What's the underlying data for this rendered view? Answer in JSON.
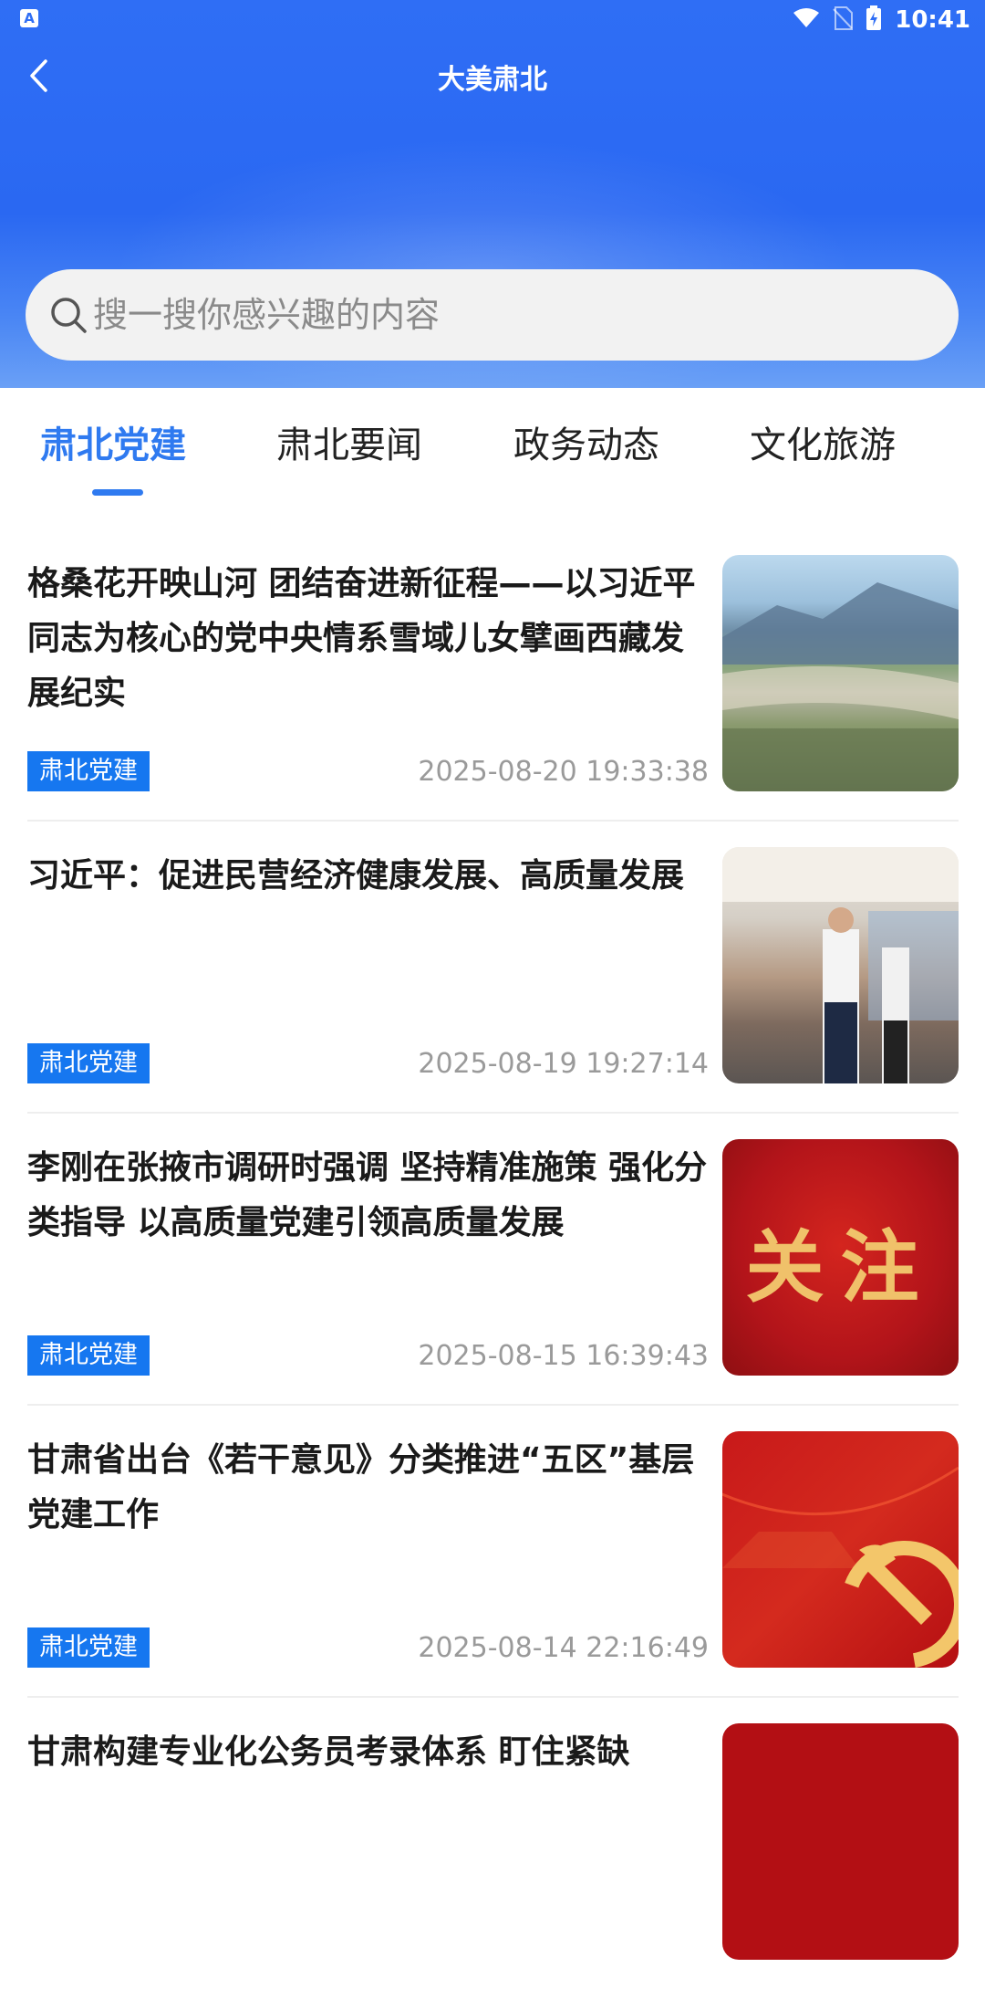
{
  "status_bar": {
    "left_icon": "A",
    "time": "10:41",
    "icons": [
      "wifi-icon",
      "no-sim-icon",
      "battery-charging-icon"
    ]
  },
  "header": {
    "title": "大美肃北",
    "back_icon": "chevron-left-icon"
  },
  "search": {
    "placeholder": "搜一搜你感兴趣的内容"
  },
  "tabs": [
    {
      "label": "肃北党建",
      "active": true
    },
    {
      "label": "肃北要闻",
      "active": false
    },
    {
      "label": "政务动态",
      "active": false
    },
    {
      "label": "文化旅游",
      "active": false
    }
  ],
  "news": [
    {
      "title": "格桑花开映山河 团结奋进新征程——以习近平同志为核心的党中央情系雪域儿女擘画西藏发展纪实",
      "tag": "肃北党建",
      "time": "2025-08-20 19:33:38"
    },
    {
      "title": "习近平：促进民营经济健康发展、高质量发展",
      "tag": "肃北党建",
      "time": "2025-08-19 19:27:14"
    },
    {
      "title": "李刚在张掖市调研时强调 坚持精准施策 强化分类指导 以高质量党建引领高质量发展",
      "tag": "肃北党建",
      "time": "2025-08-15 16:39:43",
      "thumb_text": "关注"
    },
    {
      "title": "甘肃省出台《若干意见》分类推进“五区”基层党建工作",
      "tag": "肃北党建",
      "time": "2025-08-14 22:16:49"
    },
    {
      "title": "甘肃构建专业化公务员考录体系 盯住紧缺"
    }
  ]
}
